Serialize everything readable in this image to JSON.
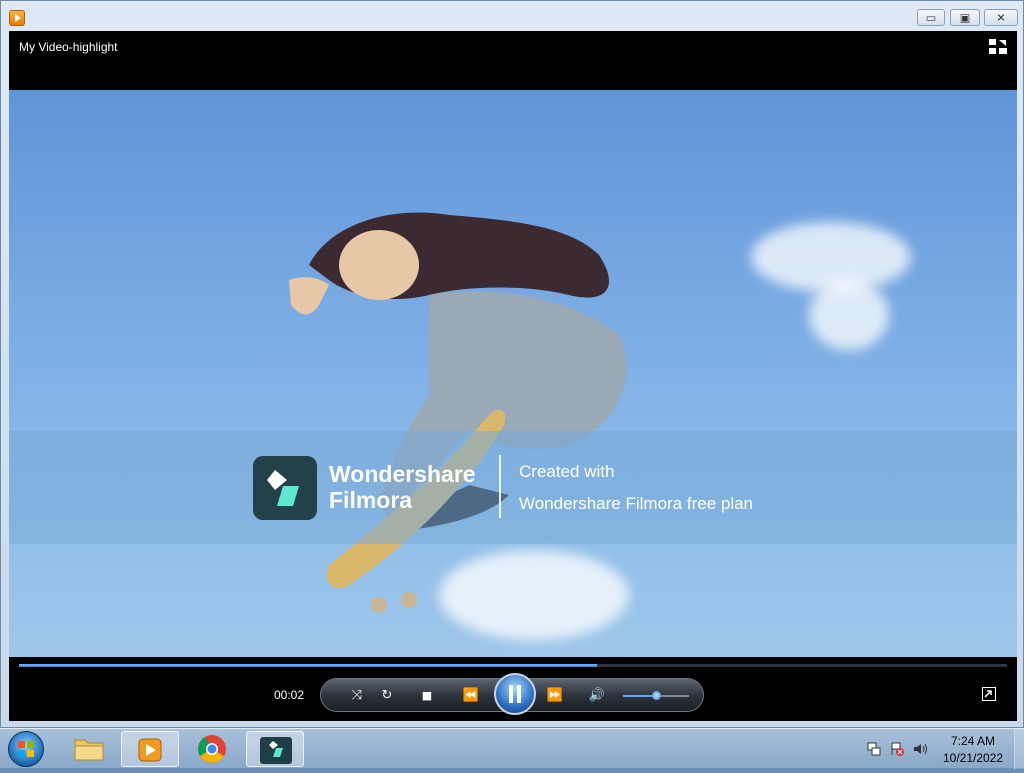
{
  "window": {
    "title": "My Video-highlight",
    "controls": {
      "minimize": "▭",
      "maximize": "▣",
      "close": "✕"
    }
  },
  "player": {
    "watermark": {
      "brand_line1": "Wondershare",
      "brand_line2": "Filmora",
      "created_with": "Created with",
      "plan_text": "Wondershare Filmora free plan"
    },
    "time": "00:02",
    "progress_fraction": 0.585,
    "volume_fraction": 0.5,
    "controls": [
      {
        "name": "shuffle-icon",
        "glyph": "⤨"
      },
      {
        "name": "repeat-icon",
        "glyph": "↻"
      },
      {
        "name": "stop-icon",
        "glyph": "■"
      },
      {
        "name": "previous-icon",
        "glyph": "⏪"
      },
      {
        "name": "pause-icon",
        "glyph": ""
      },
      {
        "name": "next-icon",
        "glyph": "⏩"
      },
      {
        "name": "volume-icon",
        "glyph": "🔊"
      }
    ]
  },
  "taskbar": {
    "apps": [
      {
        "name": "taskbar-explorer",
        "icon": "folder-icon"
      },
      {
        "name": "taskbar-media-player",
        "icon": "media-player-icon",
        "active": true
      },
      {
        "name": "taskbar-chrome",
        "icon": "chrome-icon"
      },
      {
        "name": "taskbar-filmora",
        "icon": "filmora-icon",
        "active": true
      }
    ],
    "tray": {
      "time": "7:24 AM",
      "date": "10/21/2022"
    }
  },
  "colors": {
    "accent": "#3f7fd8",
    "player_bg": "#000000",
    "sky": "#7aabe4"
  }
}
